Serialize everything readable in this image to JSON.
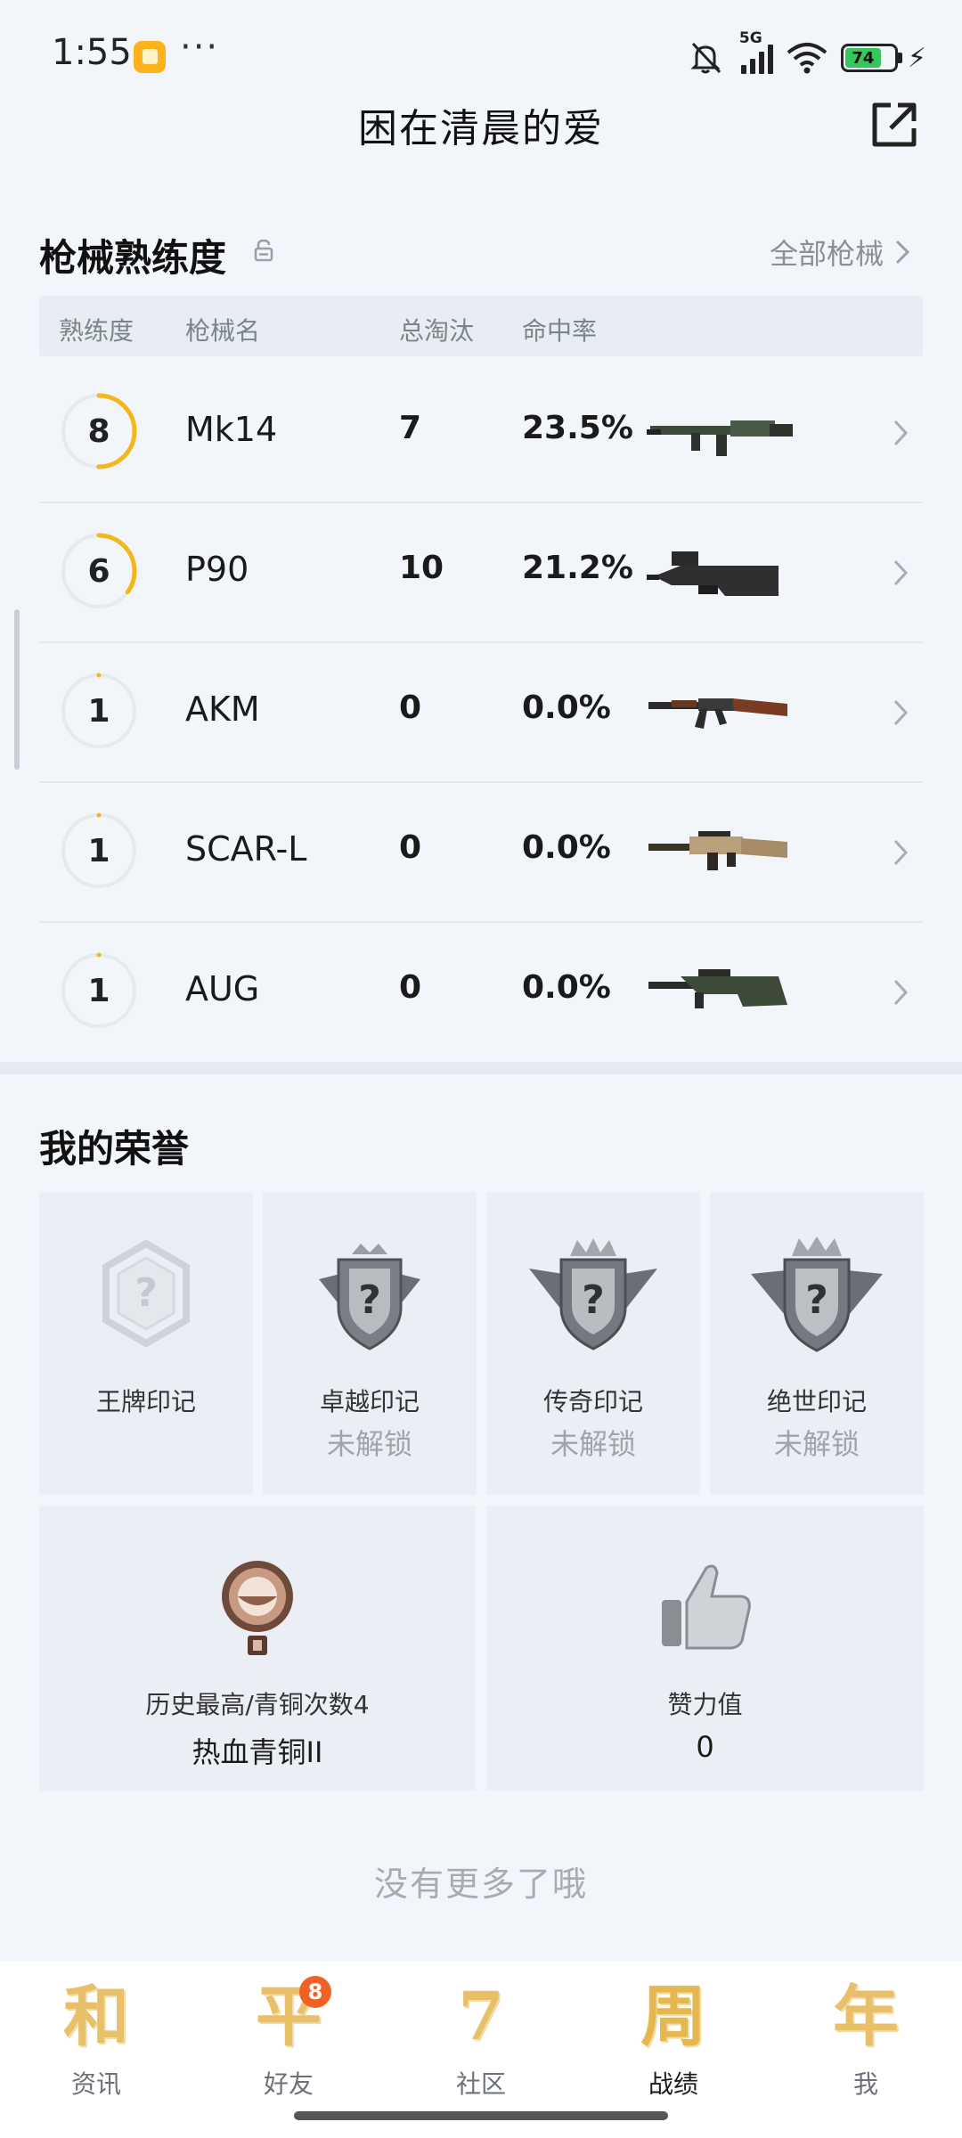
{
  "status_bar": {
    "time": "1:55",
    "dots": "···",
    "network": "5G",
    "battery": "74",
    "battery_level": 0.74
  },
  "header": {
    "title": "困在清晨的爱",
    "share_icon": "share-external-icon"
  },
  "weapons": {
    "title": "枪械熟练度",
    "all_link": "全部枪械",
    "columns": [
      "熟练度",
      "枪械名",
      "总淘汰",
      "命中率"
    ],
    "rows": [
      {
        "level": "8",
        "name": "Mk14",
        "kills": "7",
        "accuracy": "23.5%",
        "progress": 0.5
      },
      {
        "level": "6",
        "name": "P90",
        "kills": "10",
        "accuracy": "21.2%",
        "progress": 0.35
      },
      {
        "level": "1",
        "name": "AKM",
        "kills": "0",
        "accuracy": "0.0%",
        "progress": 0
      },
      {
        "level": "1",
        "name": "SCAR-L",
        "kills": "0",
        "accuracy": "0.0%",
        "progress": 0
      },
      {
        "level": "1",
        "name": "AUG",
        "kills": "0",
        "accuracy": "0.0%",
        "progress": 0
      }
    ]
  },
  "honors": {
    "title": "我的荣誉",
    "badges": [
      {
        "label": "王牌印记",
        "status": ""
      },
      {
        "label": "卓越印记",
        "status": "未解锁"
      },
      {
        "label": "传奇印记",
        "status": "未解锁"
      },
      {
        "label": "绝世印记",
        "status": "未解锁"
      }
    ],
    "rank": {
      "label": "历史最高/青铜次数4",
      "value": "热血青铜II"
    },
    "likes": {
      "label": "赞力值",
      "value": "0"
    }
  },
  "footer": {
    "no_more": "没有更多了哦"
  },
  "nav": {
    "items": [
      {
        "glyph": "和",
        "label": "资讯"
      },
      {
        "glyph": "平",
        "label": "好友",
        "badge": "8"
      },
      {
        "glyph": "7",
        "label": "社区"
      },
      {
        "glyph": "周",
        "label": "战绩"
      },
      {
        "glyph": "年",
        "label": "我"
      }
    ],
    "active": "战绩"
  },
  "colors": {
    "accent": "#f3b71c",
    "background": "#f2f5fa",
    "badge": "#f06224"
  }
}
